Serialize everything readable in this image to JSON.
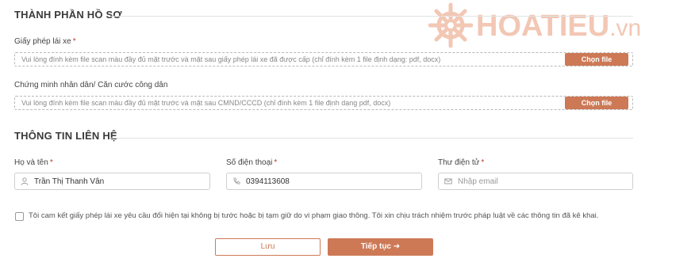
{
  "profile_section": {
    "title": "THÀNH PHẦN HỒ SƠ"
  },
  "license_upload": {
    "label": "Giấy phép lái xe",
    "required_mark": "*",
    "hint": "Vui lòng đính kèm file scan màu đầy đủ mặt trước và mặt sau giấy phép lái xe đã được cấp (chỉ đính kèm 1 file định dạng: pdf, docx)",
    "button": "Chọn file"
  },
  "id_upload": {
    "label": "Chứng minh nhân dân/ Căn cước công dân",
    "hint": "Vui lòng đính kèm file scan màu đầy đủ mặt trước và mặt sau CMND/CCCD (chỉ đính kèm 1 file định dạng pdf, docx)",
    "button": "Chọn file"
  },
  "contact_section": {
    "title": "THÔNG TIN LIÊN HỆ"
  },
  "fields": {
    "name": {
      "label": "Họ và tên",
      "required_mark": "*",
      "value": "Trần Thị Thanh Vân",
      "icon": "user-icon"
    },
    "phone": {
      "label": "Số điện thoại",
      "required_mark": "*",
      "value": "0394113608",
      "icon": "phone-icon"
    },
    "email": {
      "label": "Thư điện tử",
      "required_mark": "*",
      "placeholder": "Nhập email",
      "icon": "mail-icon"
    }
  },
  "commitment": {
    "text": "Tôi cam kết giấy phép lái xe yêu cầu đổi hiện tại không bị tước hoặc bị tạm giữ do vi phạm giao thông. Tôi xin chịu trách nhiệm trước pháp luật về các thông tin đã kê khai.",
    "checked": false
  },
  "actions": {
    "save": "Lưu",
    "next": "Tiếp tục",
    "next_arrow": "➔"
  },
  "watermark": {
    "brand": "HOATIEU",
    "suffix": ".vn"
  },
  "colors": {
    "accent": "#cd7956",
    "watermark": "#f2c7b4"
  }
}
